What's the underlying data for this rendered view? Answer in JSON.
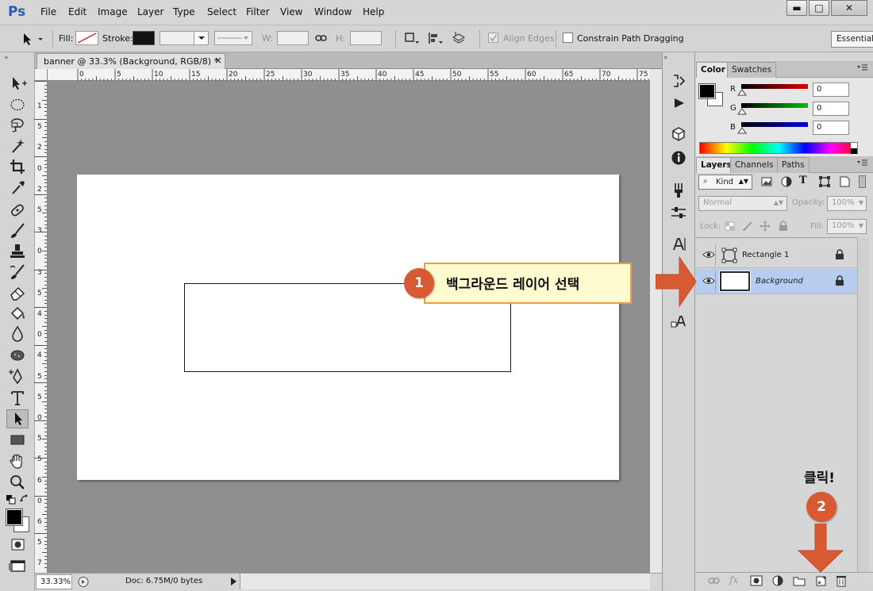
{
  "app": {
    "logo": "Ps"
  },
  "menu": [
    "File",
    "Edit",
    "Image",
    "Layer",
    "Type",
    "Select",
    "Filter",
    "View",
    "Window",
    "Help"
  ],
  "window_controls": {
    "minimize": "▬",
    "maximize": "□",
    "close": "✕"
  },
  "options": {
    "fill_label": "Fill:",
    "stroke_label": "Stroke:",
    "w_label": "W:",
    "h_label": "H:",
    "align_edges": "Align Edges",
    "constrain": "Constrain Path Dragging",
    "workspace": "Essential"
  },
  "document": {
    "tab_title": "banner @ 33.3% (Background, RGB/8) *",
    "ruler_h": [
      "0",
      "5",
      "10",
      "15",
      "20",
      "25",
      "30",
      "35",
      "40",
      "45",
      "50",
      "55",
      "60",
      "65",
      "70",
      "75"
    ],
    "ruler_v": [
      "1",
      "5",
      "2",
      "0",
      "2",
      "5",
      "3",
      "0",
      "3",
      "5",
      "4",
      "0",
      "4",
      "5",
      "5",
      "0",
      "5",
      "5",
      "6",
      "0",
      "6",
      "5",
      "7"
    ],
    "zoom": "33.33%",
    "doc_size": "Doc: 6.75M/0 bytes"
  },
  "color_panel": {
    "tabs": [
      "Color",
      "Swatches"
    ],
    "sliders": [
      {
        "label": "R",
        "value": "0",
        "color": "#e00000"
      },
      {
        "label": "G",
        "value": "0",
        "color": "#00c000"
      },
      {
        "label": "B",
        "value": "0",
        "color": "#0000e0"
      }
    ]
  },
  "layers_panel": {
    "tabs": [
      "Layers",
      "Channels",
      "Paths"
    ],
    "filter": "Kind",
    "blend_mode": "Normal",
    "opacity_label": "Opacity:",
    "opacity": "100%",
    "lock_label": "Lock:",
    "fill_label": "Fill:",
    "fill": "100%",
    "layers": [
      {
        "name": "Rectangle 1",
        "selected": false
      },
      {
        "name": "Background",
        "selected": true
      }
    ]
  },
  "annotations": {
    "step1_num": "1",
    "step1_text": "백그라운드 레이어 선택",
    "step2_num": "2",
    "step2_text": "클릭!",
    "accent": "#d85a33"
  }
}
